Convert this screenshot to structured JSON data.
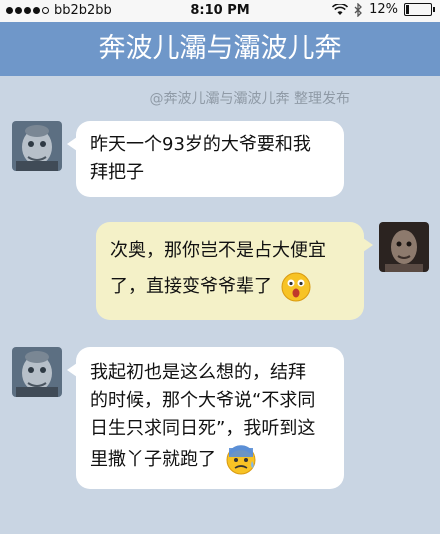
{
  "status_bar": {
    "carrier": "bb2b2bb",
    "time": "8:10 PM",
    "battery": "12%",
    "battery_level": 0.12,
    "icons": [
      "signal-dots-icon",
      "wifi-icon",
      "bluetooth-icon",
      "battery-icon"
    ]
  },
  "header": {
    "title": "奔波儿灞与灞波儿奔"
  },
  "watermark": "@奔波儿灞与灞波儿奔 整理发布",
  "messages": [
    {
      "side": "left",
      "lines": [
        "昨天一个93岁的大爷要和我",
        "拜把子"
      ]
    },
    {
      "side": "right",
      "lines": [
        "次奥，那你岂不是占大便宜",
        "了，直接变爷爷辈了"
      ],
      "emoji": "surprised-face-icon"
    },
    {
      "side": "left",
      "lines": [
        "我起初也是这么想的，结拜",
        "的时候，那个大爷说“不求同",
        "日生只求同日死”，我听到这",
        "里撒丫子就跑了"
      ],
      "emoji": "anxious-sweat-face-icon"
    }
  ],
  "colors": {
    "background": "#c9d5e3",
    "header": "#6f97c9",
    "left_bubble": "#ffffff",
    "right_bubble": "#f4f1c8"
  }
}
